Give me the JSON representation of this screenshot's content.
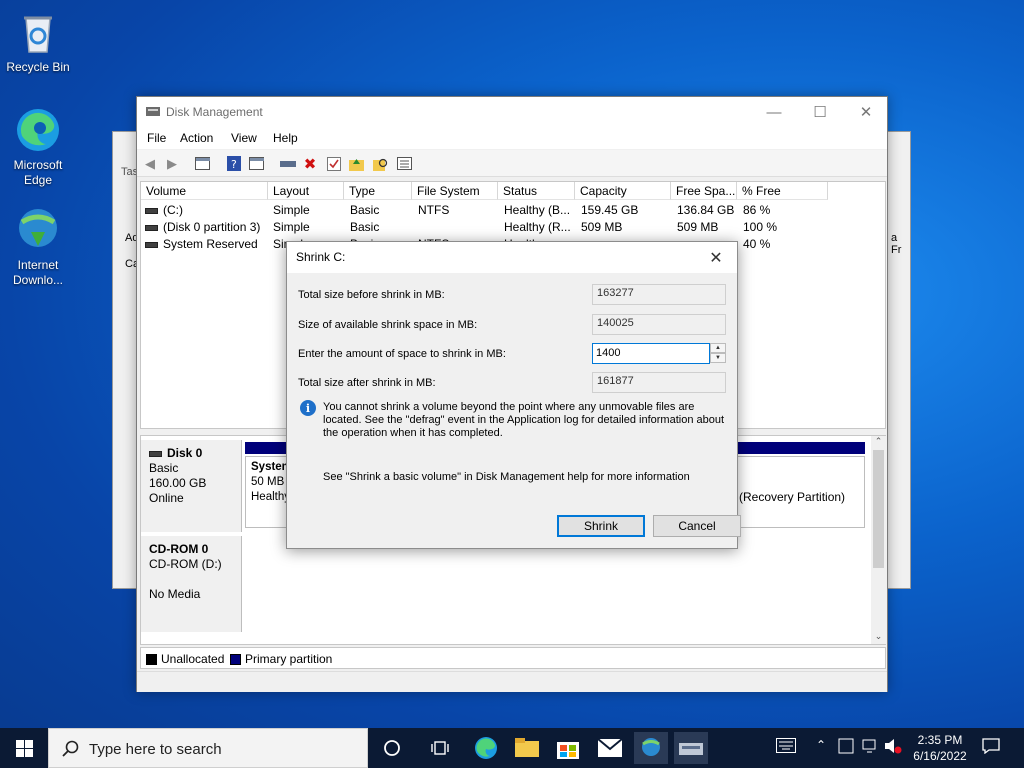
{
  "desktop": {
    "icons": [
      {
        "label": "Recycle Bin"
      },
      {
        "label": "Microsoft Edge"
      },
      {
        "label": "Internet Downlo..."
      }
    ]
  },
  "bg_window": {
    "fragments": [
      "Tas",
      "Ad",
      "Ca",
      "a Fr"
    ]
  },
  "window": {
    "title": "Disk Management",
    "menu": [
      "File",
      "Action",
      "View",
      "Help"
    ],
    "columns": [
      "Volume",
      "Layout",
      "Type",
      "File System",
      "Status",
      "Capacity",
      "Free Spa...",
      "% Free"
    ],
    "rows": [
      {
        "volume": "(C:)",
        "layout": "Simple",
        "type": "Basic",
        "fs": "NTFS",
        "status": "Healthy (B...",
        "capacity": "159.45 GB",
        "free": "136.84 GB",
        "pct": "86 %"
      },
      {
        "volume": "(Disk 0 partition 3)",
        "layout": "Simple",
        "type": "Basic",
        "fs": "",
        "status": "Healthy (R...",
        "capacity": "509 MB",
        "free": "509 MB",
        "pct": "100 %"
      },
      {
        "volume": "System Reserved",
        "layout": "Simple",
        "type": "Basic",
        "fs": "NTFS",
        "status": "Healthy",
        "capacity": "",
        "free": "",
        "pct": "40 %"
      }
    ],
    "disks": [
      {
        "name": "Disk 0",
        "type": "Basic",
        "size": "160.00 GB",
        "state": "Online",
        "partition_name": "System",
        "partition_size": "50 MB",
        "partition_status": "Healthy",
        "right_partition": "(Recovery Partition)"
      },
      {
        "name": "CD-ROM 0",
        "type": "CD-ROM (D:)",
        "state": "No Media"
      }
    ],
    "legend": [
      {
        "label": "Unallocated",
        "color": "#000000"
      },
      {
        "label": "Primary partition",
        "color": "#00007a"
      }
    ]
  },
  "dialog": {
    "title": "Shrink C:",
    "total_before_label": "Total size before shrink in MB:",
    "total_before_value": "163277",
    "available_label": "Size of available shrink space in MB:",
    "available_value": "140025",
    "amount_label": "Enter the amount of space to shrink in MB:",
    "amount_value": "1400",
    "total_after_label": "Total size after shrink in MB:",
    "total_after_value": "161877",
    "info_text": "You cannot shrink a volume beyond the point where any unmovable files are located. See the \"defrag\" event in the Application log for detailed information about the operation when it has completed.",
    "help_text": "See \"Shrink a basic volume\" in Disk Management help for more information",
    "shrink_label": "Shrink",
    "cancel_label": "Cancel"
  },
  "taskbar": {
    "search_placeholder": "Type here to search",
    "time": "2:35 PM",
    "date": "6/16/2022"
  }
}
